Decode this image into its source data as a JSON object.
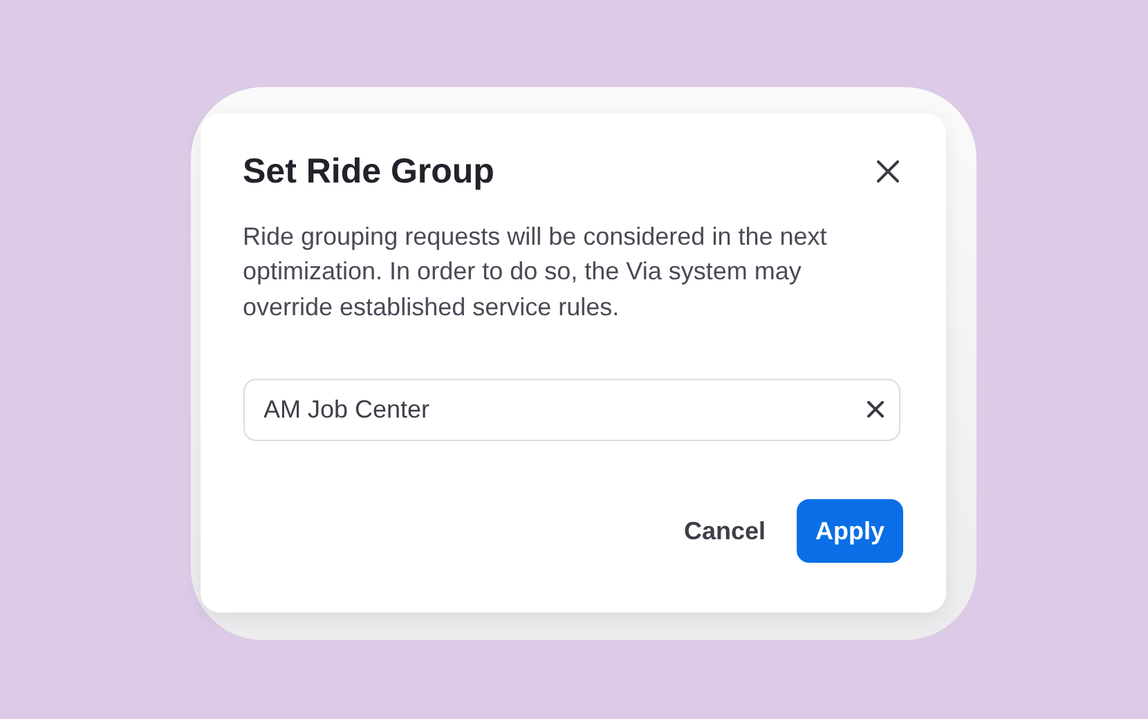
{
  "dialog": {
    "title": "Set Ride Group",
    "message": "Ride grouping requests will be considered in the next optimization. In order to do so, the Via system may override established service rules.",
    "field": {
      "value": "AM Job Center"
    },
    "buttons": [
      {
        "label": "Cancel",
        "kind": "secondary"
      },
      {
        "label": "Apply",
        "kind": "primary"
      }
    ]
  }
}
